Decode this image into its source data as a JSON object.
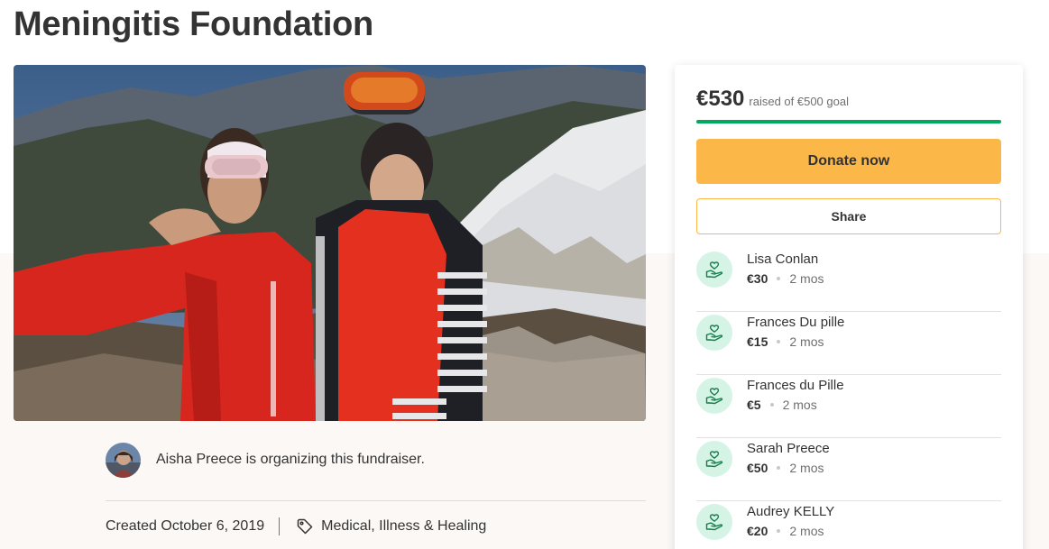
{
  "campaign": {
    "title": "Meningitis Foundation",
    "organizer_text": "Aisha Preece is organizing this fundraiser.",
    "created": "Created October 6, 2019",
    "category": "Medical, Illness & Healing"
  },
  "donation_card": {
    "raised": "€530",
    "goal_text": "raised of €500 goal",
    "progress_percent": 100,
    "donate_label": "Donate now",
    "share_label": "Share"
  },
  "donors": [
    {
      "name": "Lisa Conlan",
      "amount": "€30",
      "time": "2 mos"
    },
    {
      "name": "Frances Du pille",
      "amount": "€15",
      "time": "2 mos"
    },
    {
      "name": "Frances du Pille",
      "amount": "€5",
      "time": "2 mos"
    },
    {
      "name": "Sarah Preece",
      "amount": "€50",
      "time": "2 mos"
    },
    {
      "name": "Audrey KELLY",
      "amount": "€20",
      "time": "2 mos"
    }
  ],
  "colors": {
    "accent_green": "#02a95c",
    "donate_yellow": "#fbb848",
    "donor_icon_bg": "#d5f4e6"
  },
  "icons": {
    "donor": "hand-heart-icon",
    "category": "tag-icon"
  }
}
